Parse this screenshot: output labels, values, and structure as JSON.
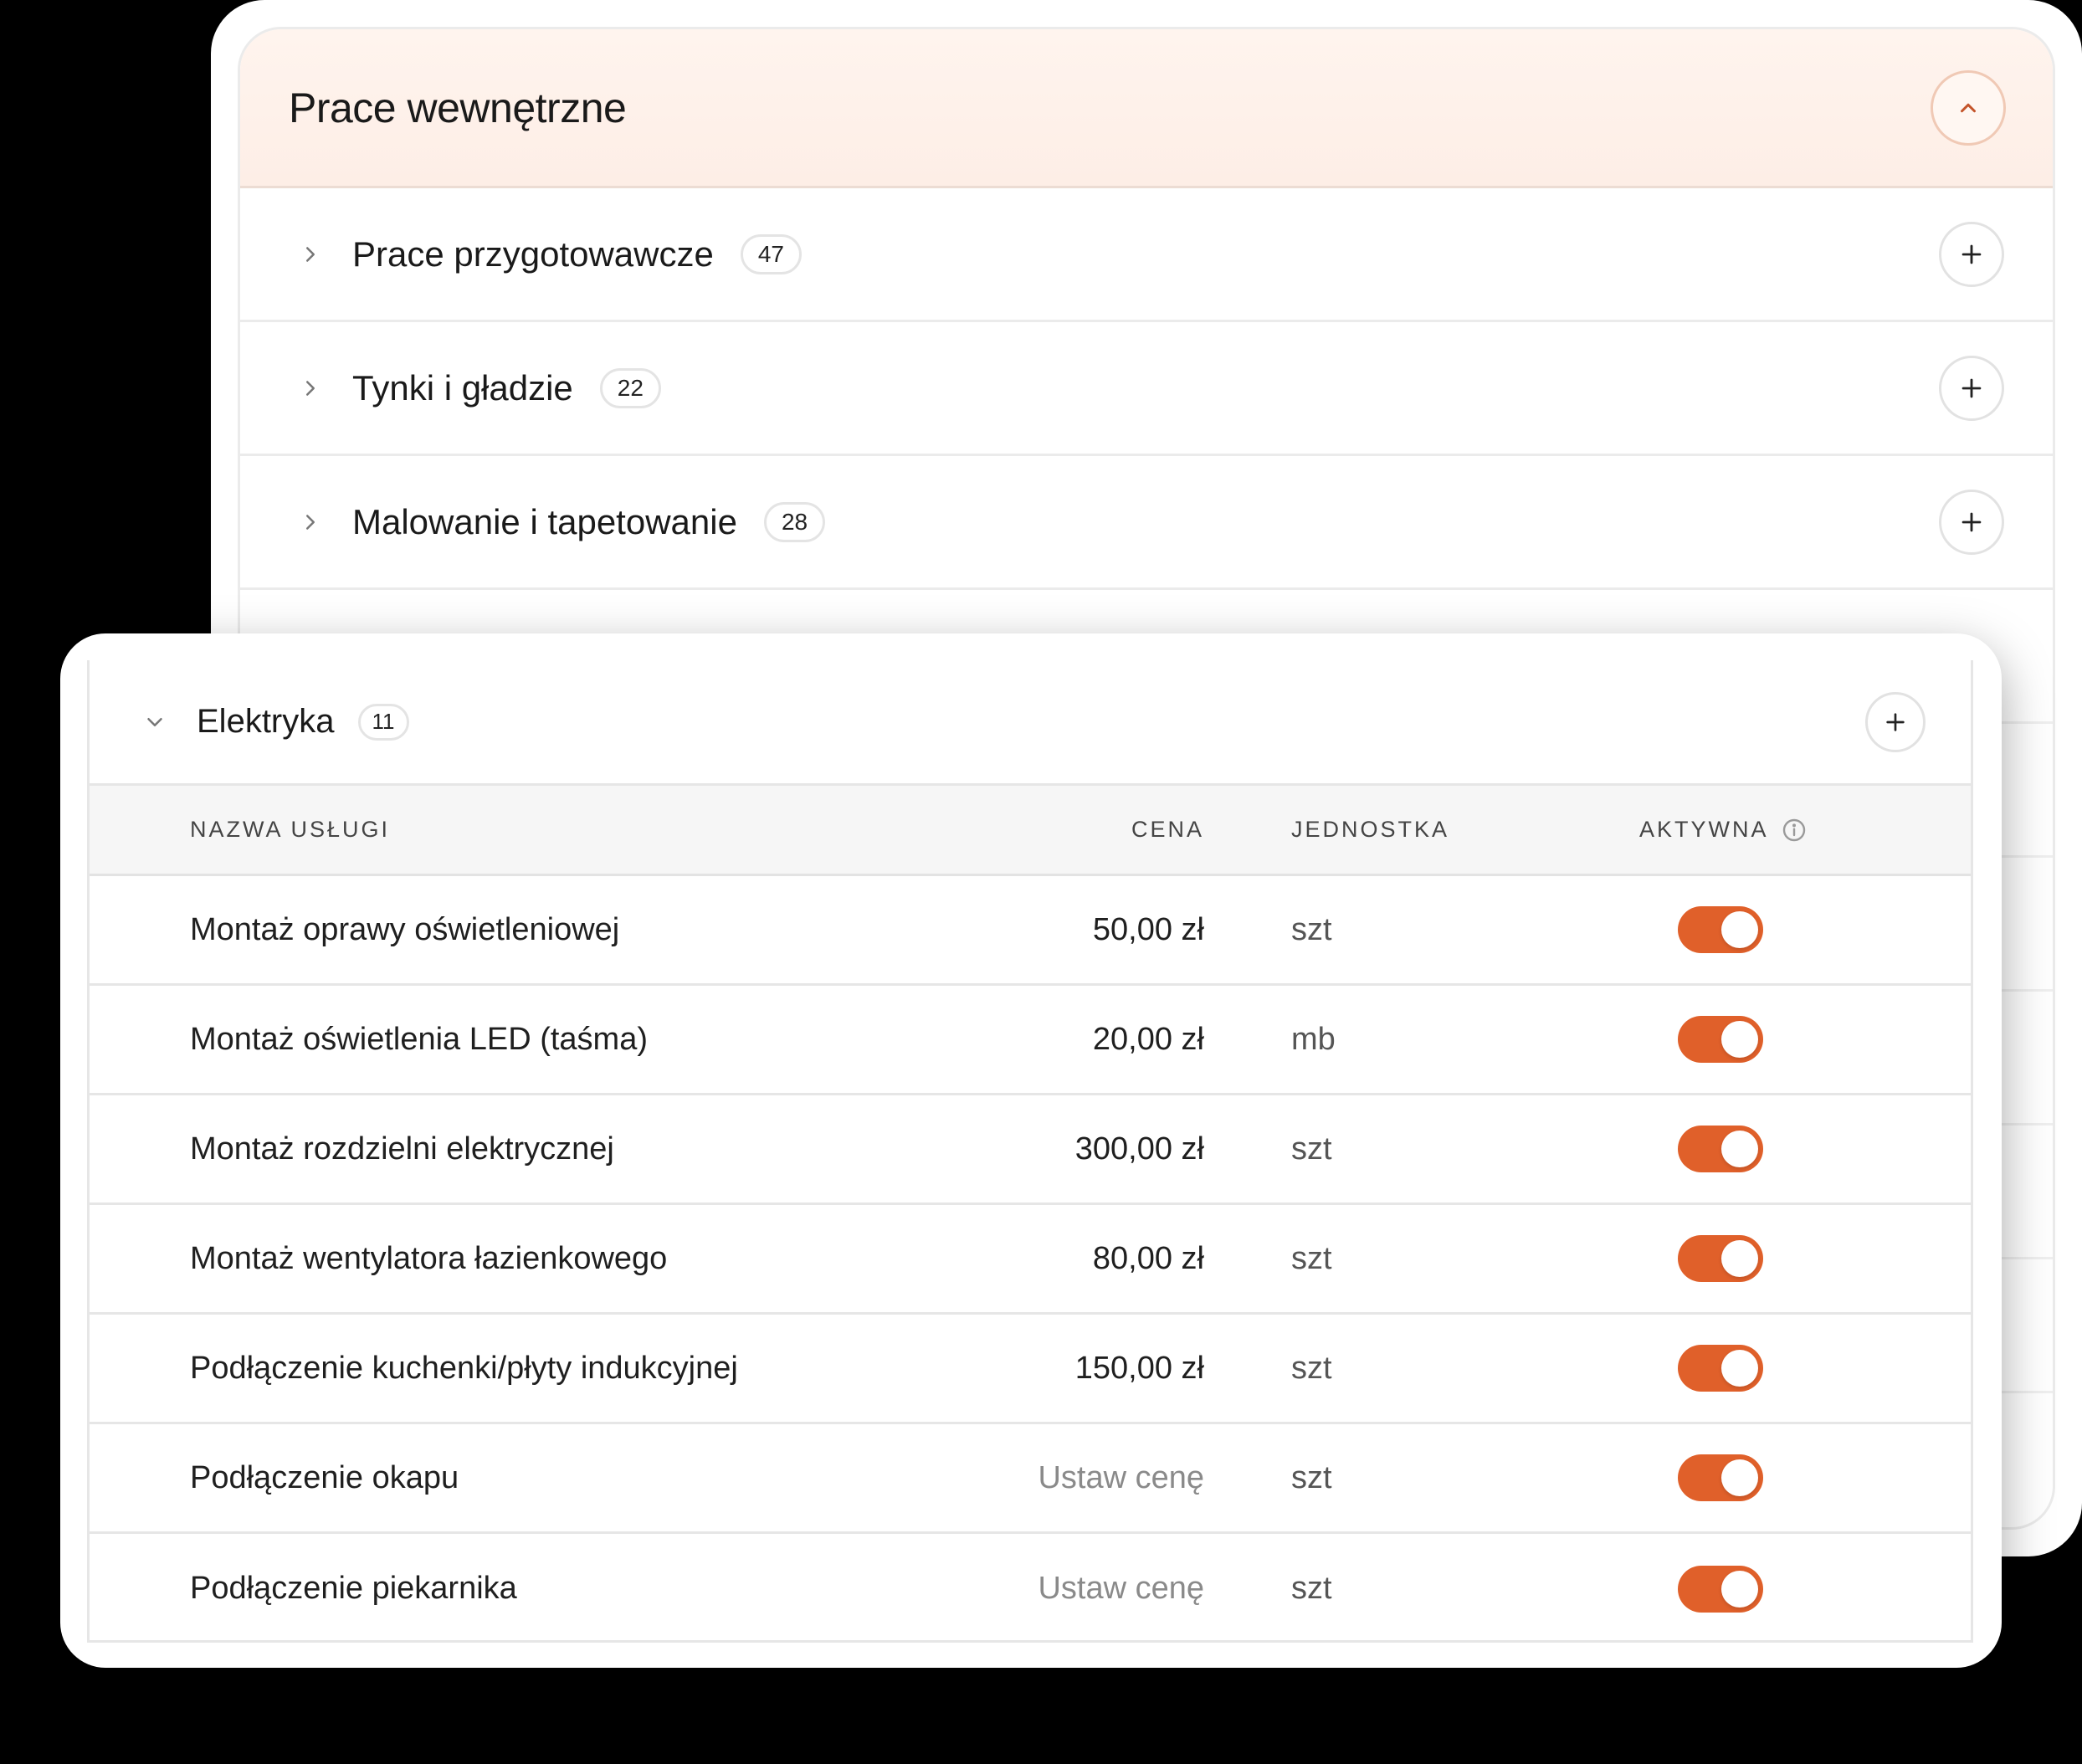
{
  "section": {
    "title": "Prace wewnętrzne",
    "categories": [
      {
        "name": "Prace przygotowawcze",
        "count": "47"
      },
      {
        "name": "Tynki i gładzie",
        "count": "22"
      },
      {
        "name": "Malowanie i tapetowanie",
        "count": "28"
      }
    ]
  },
  "expanded": {
    "name": "Elektryka",
    "count": "11",
    "columns": {
      "name": "NAZWA USŁUGI",
      "price": "CENA",
      "unit": "JEDNOSTKA",
      "active": "AKTYWNA"
    },
    "rows": [
      {
        "name": "Montaż oprawy oświetleniowej",
        "price": "50,00 zł",
        "unit": "szt",
        "active": true
      },
      {
        "name": "Montaż oświetlenia LED (taśma)",
        "price": "20,00 zł",
        "unit": "mb",
        "active": true
      },
      {
        "name": "Montaż rozdzielni elektrycznej",
        "price": "300,00 zł",
        "unit": "szt",
        "active": true
      },
      {
        "name": "Montaż wentylatora łazienkowego",
        "price": "80,00 zł",
        "unit": "szt",
        "active": true
      },
      {
        "name": "Podłączenie kuchenki/płyty indukcyjnej",
        "price": "150,00 zł",
        "unit": "szt",
        "active": true
      },
      {
        "name": "Podłączenie okapu",
        "price": "Ustaw cenę",
        "unit": "szt",
        "active": true
      },
      {
        "name": "Podłączenie piekarnika",
        "price": "Ustaw cenę",
        "unit": "szt",
        "active": true
      }
    ]
  },
  "colors": {
    "accent": "#e0602a",
    "header_tint": "#fdeee6"
  },
  "icons": {
    "collapse": "chevron-up-icon",
    "expand": "chevron-right-icon",
    "expanded": "chevron-down-icon",
    "add": "plus-icon",
    "info": "info-icon"
  }
}
